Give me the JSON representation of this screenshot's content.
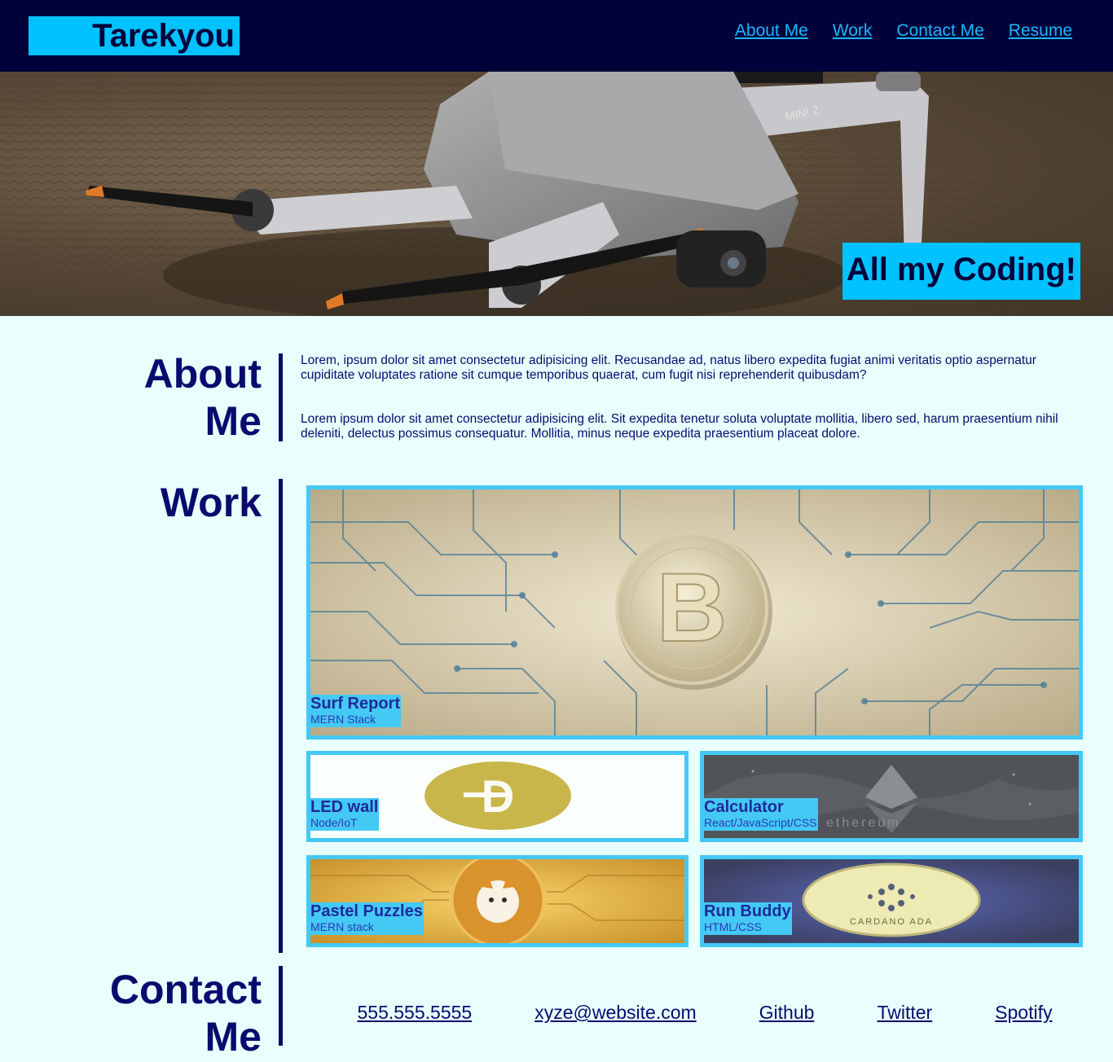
{
  "header": {
    "logo": "Tarekyou",
    "nav": [
      "About Me",
      "Work",
      "Contact Me",
      "Resume"
    ]
  },
  "hero": {
    "tagline": "All my Coding!",
    "drone_text": "MINI 2"
  },
  "about": {
    "title_line1": "About",
    "title_line2": "Me",
    "paragraphs": [
      "Lorem, ipsum dolor sit amet consectetur adipisicing elit. Recusandae ad, natus libero expedita fugiat animi veritatis optio aspernatur cupiditate voluptates ratione sit cumque temporibus quaerat, cum fugit nisi reprehenderit quibusdam?",
      "Lorem ipsum dolor sit amet consectetur adipisicing elit. Sit expedita tenetur soluta voluptate mollitia, libero sed, harum praesentium nihil deleniti, delectus possimus consequatur. Mollitia, minus neque expedita praesentium placeat dolore."
    ]
  },
  "work": {
    "title": "Work",
    "projects": [
      {
        "title": "Surf Report",
        "stack": "MERN Stack",
        "image": "bitcoin-circuit-image"
      },
      {
        "title": "LED wall",
        "stack": "Node/IoT",
        "image": "dogecoin-image"
      },
      {
        "title": "Calculator",
        "stack": "React/JavaScript/CSS",
        "image": "ethereum-image",
        "watermark": "ethereum"
      },
      {
        "title": "Pastel Puzzles",
        "stack": "MERN stack",
        "image": "shiba-coin-image"
      },
      {
        "title": "Run Buddy",
        "stack": "HTML/CSS",
        "image": "cardano-image",
        "watermark": "CARDANO ADA"
      }
    ]
  },
  "contact": {
    "title_line1": "Contact",
    "title_line2": "Me",
    "links": [
      "555.555.5555",
      "xyze@website.com",
      "Github",
      "Twitter",
      "Spotify"
    ]
  },
  "colors": {
    "header_bg": "#02023a",
    "accent": "#00c2ff",
    "card_border": "#44c9f5",
    "page_bg": "#e8fffd",
    "text": "#0a0a6e"
  }
}
